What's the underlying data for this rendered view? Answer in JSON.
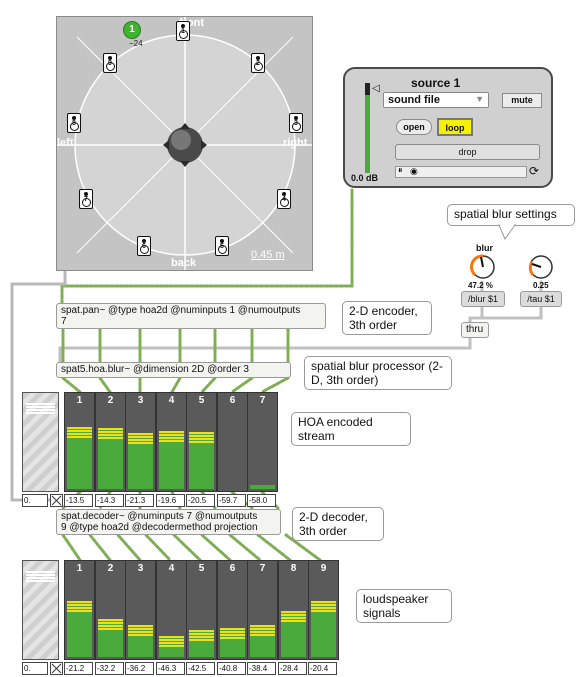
{
  "viewer": {
    "labels": {
      "front": "front",
      "left": "left",
      "right": "right",
      "back": "back"
    },
    "scale": "0.45 m",
    "source_badge": "1",
    "source_value": "−24",
    "speakers": [
      "1",
      "2",
      "3",
      "4",
      "5",
      "6",
      "7",
      "8",
      "9"
    ]
  },
  "source_panel": {
    "title": "source 1",
    "file_menu": "sound file",
    "mute": "mute",
    "open": "open",
    "loop": "loop",
    "drop": "drop",
    "level": "0.0 dB"
  },
  "blur": {
    "settings_comment": "spatial blur settings",
    "dial_label": "blur",
    "blur_value": "47.2 %",
    "tau_value": "0.25",
    "blur_msg": "/blur $1",
    "tau_msg": "/tau $1",
    "thru": "thru"
  },
  "objects": {
    "encoder": "spat.pan~ @type hoa2d @numinputs 1 @numoutputs\n7",
    "encoder_comment": "2-D encoder,\n3th order",
    "blur_proc": "spat5.hoa.blur~ @dimension 2D @order 3",
    "blur_comment": "spatial blur processor\n(2-D, 3th order)",
    "hoa_comment": "HOA encoded\nstream",
    "decoder": "spat.decoder~ @numinputs 7 @numoutputs\n9 @type hoa2d @decodermethod projection",
    "decoder_comment": "2-D decoder,\n3th order",
    "ls_comment": "loudspeaker\nsignals"
  },
  "hoa_meters": {
    "master_value": "0.",
    "channels": [
      {
        "label": "1",
        "value": "-13.5",
        "level": 0.78
      },
      {
        "label": "2",
        "value": "-14.3",
        "level": 0.76
      },
      {
        "label": "3",
        "value": "-21.3",
        "level": 0.7
      },
      {
        "label": "4",
        "value": "-19.6",
        "level": 0.72
      },
      {
        "label": "5",
        "value": "-20.5",
        "level": 0.71
      },
      {
        "label": "6",
        "value": "-59.7",
        "level": 0.0
      },
      {
        "label": "7",
        "value": "-58.0",
        "level": 0.05
      }
    ]
  },
  "ls_meters": {
    "master_value": "0.",
    "channels": [
      {
        "label": "1",
        "value": "-21.2",
        "level": 0.7
      },
      {
        "label": "2",
        "value": "-32.2",
        "level": 0.48
      },
      {
        "label": "3",
        "value": "-36.2",
        "level": 0.4
      },
      {
        "label": "4",
        "value": "-46.3",
        "level": 0.26
      },
      {
        "label": "5",
        "value": "-42.5",
        "level": 0.34
      },
      {
        "label": "6",
        "value": "-40.8",
        "level": 0.36
      },
      {
        "label": "7",
        "value": "-38.4",
        "level": 0.4
      },
      {
        "label": "8",
        "value": "-28.4",
        "level": 0.58
      },
      {
        "label": "9",
        "value": "-20.4",
        "level": 0.7
      }
    ]
  },
  "colors": {
    "meter_green": "#4aaa3c",
    "meter_yellow": "#e8e020",
    "loop_yellow": "#f4f000",
    "dial_orange": "#f07a10",
    "cord_green": "#8fbf60"
  }
}
